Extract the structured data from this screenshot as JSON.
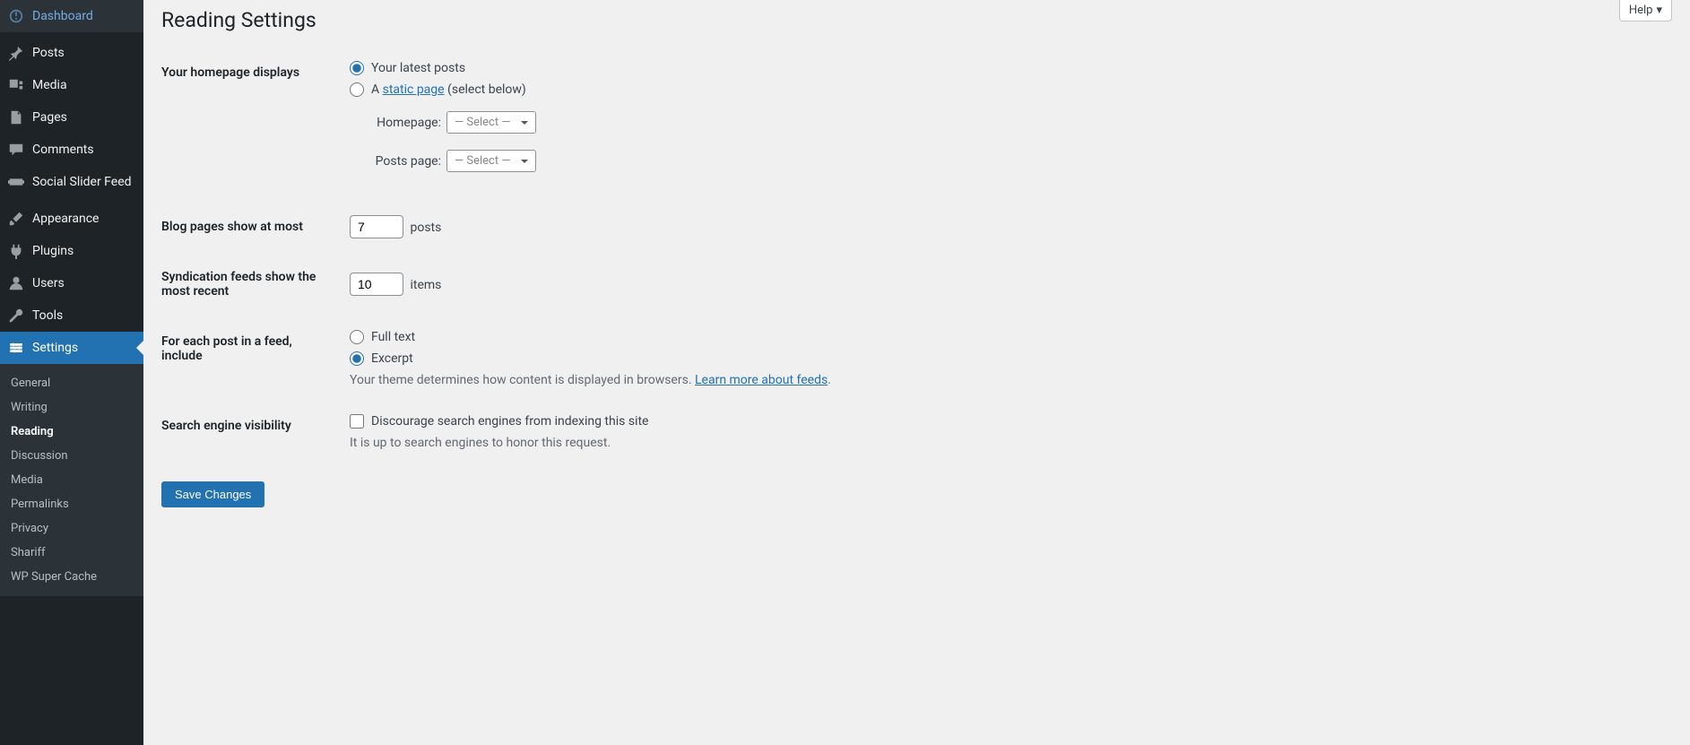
{
  "help_label": "Help",
  "sidebar": {
    "items": [
      {
        "label": "Dashboard"
      },
      {
        "label": "Posts"
      },
      {
        "label": "Media"
      },
      {
        "label": "Pages"
      },
      {
        "label": "Comments"
      },
      {
        "label": "Social Slider Feed"
      },
      {
        "label": "Appearance"
      },
      {
        "label": "Plugins"
      },
      {
        "label": "Users"
      },
      {
        "label": "Tools"
      },
      {
        "label": "Settings"
      }
    ],
    "submenu": [
      {
        "label": "General"
      },
      {
        "label": "Writing"
      },
      {
        "label": "Reading"
      },
      {
        "label": "Discussion"
      },
      {
        "label": "Media"
      },
      {
        "label": "Permalinks"
      },
      {
        "label": "Privacy"
      },
      {
        "label": "Shariff"
      },
      {
        "label": "WP Super Cache"
      }
    ]
  },
  "page": {
    "title": "Reading Settings",
    "homepage_displays_label": "Your homepage displays",
    "homepage_radio1": "Your latest posts",
    "homepage_radio2_prefix": "A ",
    "homepage_radio2_link": "static page",
    "homepage_radio2_suffix": " (select below)",
    "homepage_select_label": "Homepage:",
    "posts_page_select_label": "Posts page:",
    "select_placeholder": "— Select —",
    "blog_pages_label": "Blog pages show at most",
    "blog_pages_value": "7",
    "blog_pages_unit": "posts",
    "syndication_label": "Syndication feeds show the most recent",
    "syndication_value": "10",
    "syndication_unit": "items",
    "feed_include_label": "For each post in a feed, include",
    "feed_full_text": "Full text",
    "feed_excerpt": "Excerpt",
    "feed_description_prefix": "Your theme determines how content is displayed in browsers. ",
    "feed_description_link": "Learn more about feeds",
    "feed_description_suffix": ".",
    "visibility_label": "Search engine visibility",
    "visibility_checkbox": "Discourage search engines from indexing this site",
    "visibility_description": "It is up to search engines to honor this request.",
    "save_button": "Save Changes"
  }
}
